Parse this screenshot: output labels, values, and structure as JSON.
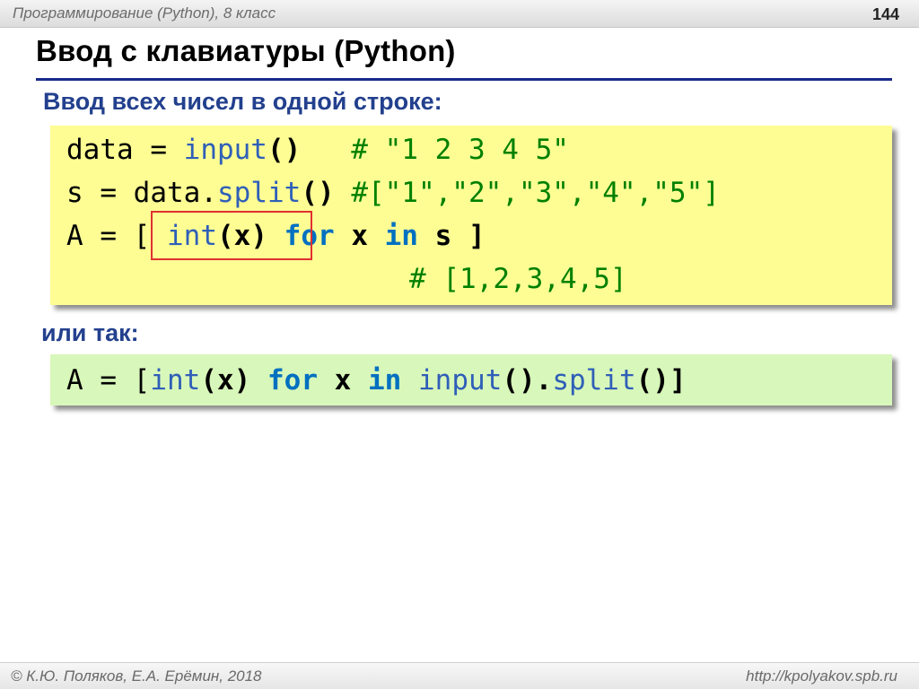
{
  "header": {
    "course": "Программирование (Python), 8 класс",
    "page_number": "144"
  },
  "slide": {
    "title": "Ввод с клавиатуры (Python)",
    "subtitle": "Ввод всех чисел в одной строке:",
    "or_label": "или так:"
  },
  "code1": {
    "l1_var": "data",
    "l1_eq": " = ",
    "l1_func": "input",
    "l1_parens": "()",
    "l1_comment": "   # \"1 2 3 4 5\"",
    "l2_var": "s",
    "l2_eq": " = ",
    "l2_obj": "data.",
    "l2_func": "split",
    "l2_parens": "()",
    "l2_comment": " #[\"1\",\"2\",\"3\",\"4\",\"5\"]",
    "l3_var": "A",
    "l3_eq": " = ",
    "l3_open": "[ ",
    "l3_int": "int",
    "l3_arg": "(x)",
    "l3_for": " for",
    "l3_x": " x",
    "l3_in": " in",
    "l3_s": " s ]",
    "l4_comment": "# [1,2,3,4,5]"
  },
  "code2": {
    "var": "A",
    "eq": " = ",
    "open": "[",
    "int": "int",
    "arg": "(x)",
    "for": " for",
    "x": " x",
    "in": " in",
    "input": " input",
    "p1": "().",
    "split": "split",
    "p2": "()]"
  },
  "footer": {
    "author": "© К.Ю. Поляков, Е.А. Ерёмин, 2018",
    "url": "http://kpolyakov.spb.ru"
  },
  "colors": {
    "title_rule": "#1a2a8a",
    "subtitle": "#23408e",
    "code_box_1": "#fdfd94",
    "code_box_2": "#d8f7ba",
    "highlight_border": "#e03030"
  }
}
